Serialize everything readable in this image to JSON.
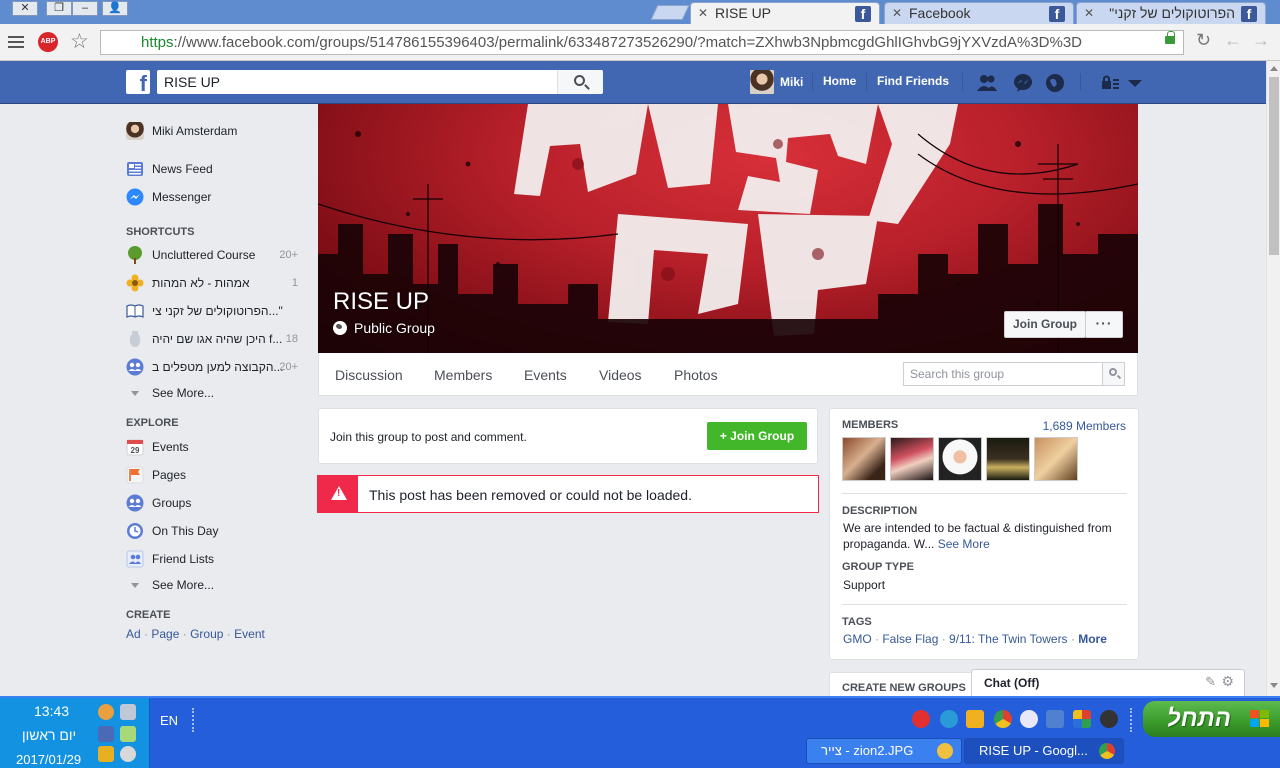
{
  "browser": {
    "tabs": [
      {
        "title": "RISE UP",
        "active": true
      },
      {
        "title": "Facebook",
        "active": false
      },
      {
        "title": "הפרוטוקולים של זקני\"",
        "active": false
      }
    ],
    "url_scheme": "https",
    "url_rest": "://www.facebook.com/groups/514786155396403/permalink/633487273526290/?match=ZXhwb3NpbmcgdGhlIGhvbG9jYXVzdA%3D%3D",
    "abp_label": "ABP",
    "window_buttons": [
      "x",
      "restore",
      "minimize",
      "user"
    ]
  },
  "fb_header": {
    "search_value": "RISE UP",
    "profile_name": "Miki",
    "home_label": "Home",
    "find_friends_label": "Find Friends",
    "brand_color": "#4267b2"
  },
  "sidebar": {
    "profile_name": "Miki Amsterdam",
    "top_items": [
      {
        "label": "News Feed",
        "icon": "news-feed-icon"
      },
      {
        "label": "Messenger",
        "icon": "messenger-icon"
      }
    ],
    "shortcuts_header": "SHORTCUTS",
    "shortcuts": [
      {
        "label": "Uncluttered Course",
        "count": "20+",
        "icon": "tree-icon"
      },
      {
        "label": "אמהות - לא המהות",
        "count": "1",
        "icon": "flower-icon"
      },
      {
        "label": "הפרוטוקולים של זקני צי...\"",
        "count": "",
        "icon": "book-icon"
      },
      {
        "label": "היכן שהיה אגו שם יהיה f...",
        "count": "18",
        "icon": "vase-icon"
      },
      {
        "label": "הקבוצה למען מטפלים ב...",
        "count": "20+",
        "icon": "group-icon"
      }
    ],
    "see_more_1": "See More...",
    "explore_header": "EXPLORE",
    "explore": [
      {
        "label": "Events",
        "icon": "calendar-icon",
        "badge": "29"
      },
      {
        "label": "Pages",
        "icon": "flag-icon"
      },
      {
        "label": "Groups",
        "icon": "groups-icon"
      },
      {
        "label": "On This Day",
        "icon": "clock-icon"
      },
      {
        "label": "Friend Lists",
        "icon": "friend-list-icon"
      }
    ],
    "see_more_2": "See More...",
    "create_header": "CREATE",
    "create_links": [
      "Ad",
      "Page",
      "Group",
      "Event"
    ]
  },
  "group": {
    "name": "RISE UP",
    "privacy": "Public Group",
    "join_label": "Join Group",
    "more_label": "···",
    "tabs": [
      "Discussion",
      "Members",
      "Events",
      "Videos",
      "Photos"
    ],
    "search_placeholder": "Search this group"
  },
  "main": {
    "join_prompt": "Join this group to post and comment.",
    "join_button": "Join Group",
    "error_text": "This post has been removed or could not be loaded."
  },
  "right": {
    "members_header": "MEMBERS",
    "members_count": "1,689 Members",
    "description_header": "DESCRIPTION",
    "description_text": "We are intended to be factual & distinguished from propaganda. W...",
    "see_more": "See More",
    "group_type_header": "GROUP TYPE",
    "group_type": "Support",
    "tags_header": "TAGS",
    "tags": [
      "GMO",
      "False Flag",
      "9/11: The Twin Towers"
    ],
    "tags_more": "More",
    "create_groups_header": "CREATE NEW GROUPS",
    "chat_label": "Chat (Off)"
  },
  "taskbar": {
    "time": "13:43",
    "day": "יום ראשון",
    "date": "2017/01/29",
    "lang": "EN",
    "start_label": "התחל",
    "tasks": [
      {
        "label": "צייר - zion2.JPG",
        "active": false
      },
      {
        "label": "RISE UP - Googl...",
        "active": true
      }
    ]
  }
}
